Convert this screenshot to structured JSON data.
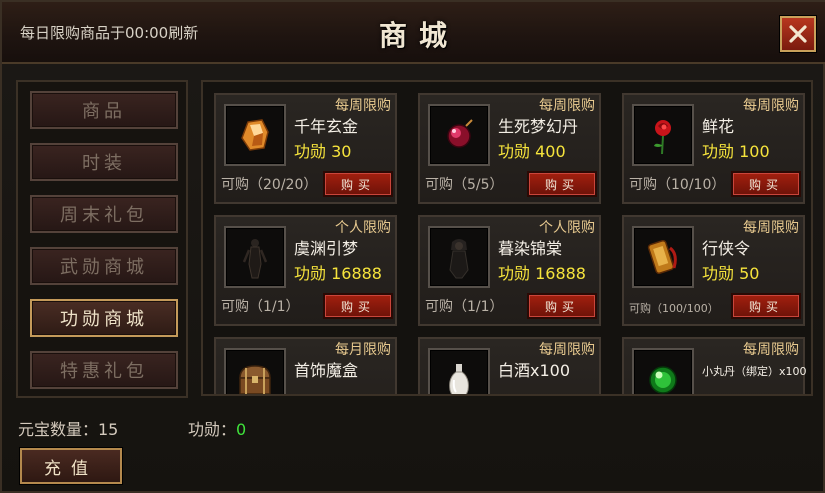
{
  "header": {
    "refresh_note": "每日限购商品于00:00刷新",
    "title": "商城"
  },
  "nav": {
    "items": [
      {
        "label": "商品",
        "active": false
      },
      {
        "label": "时装",
        "active": false
      },
      {
        "label": "周末礼包",
        "active": false
      },
      {
        "label": "武勋商城",
        "active": false
      },
      {
        "label": "功勋商城",
        "active": true
      },
      {
        "label": "特惠礼包",
        "active": false
      }
    ]
  },
  "products": [
    {
      "limit": "每周限购",
      "name": "千年玄金",
      "price": "功勋 30",
      "stock": "可购（20/20）",
      "buy": "购买",
      "icon": "amber-crystal-icon"
    },
    {
      "limit": "每周限购",
      "name": "生死梦幻丹",
      "price": "功勋 400",
      "stock": "可购（5/5）",
      "buy": "购买",
      "icon": "red-pill-icon"
    },
    {
      "limit": "每周限购",
      "name": "鲜花",
      "price": "功勋 100",
      "stock": "可购（10/10）",
      "buy": "购买",
      "icon": "rose-icon"
    },
    {
      "limit": "个人限购",
      "name": "虞渊引梦",
      "price": "功勋 16888",
      "stock": "可购（1/1）",
      "buy": "购买",
      "icon": "character-figure-icon"
    },
    {
      "limit": "个人限购",
      "name": "暮染锦棠",
      "price": "功勋 16888",
      "stock": "可购（1/1）",
      "buy": "购买",
      "icon": "dark-figure-icon"
    },
    {
      "limit": "每周限购",
      "name": "行侠令",
      "price": "功勋 50",
      "stock": "可购（100/100）",
      "buy": "购买",
      "icon": "token-scroll-icon"
    },
    {
      "limit": "每月限购",
      "name": "首饰魔盒",
      "price": "",
      "stock": "",
      "buy": "",
      "icon": "treasure-chest-icon"
    },
    {
      "limit": "每周限购",
      "name": "白酒x100",
      "price": "",
      "stock": "",
      "buy": "",
      "icon": "wine-bottle-icon"
    },
    {
      "limit": "每周限购",
      "name": "小丸丹（绑定）x100",
      "price": "",
      "stock": "",
      "buy": "",
      "icon": "green-orb-icon"
    }
  ],
  "footer": {
    "yuanbao_label": "元宝数量：15",
    "merit_label": "功勋：",
    "merit_value": "0",
    "recharge_label": "充值"
  },
  "colors": {
    "price_yellow": "#f6e43c",
    "limit_gold": "#e7c98f",
    "merit_green": "#3fe23b",
    "button_red": "#a3200f"
  }
}
